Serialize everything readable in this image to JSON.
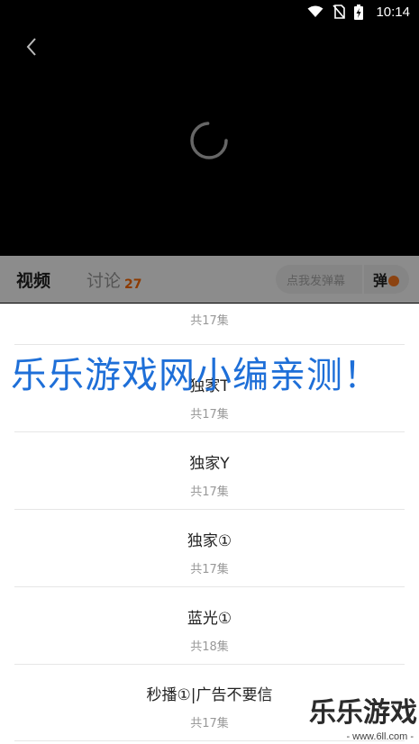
{
  "status_bar": {
    "time": "10:14"
  },
  "tabs": [
    {
      "label": "视频"
    },
    {
      "label": "讨论",
      "count": "27"
    }
  ],
  "danmu": {
    "placeholder": "点我发弹幕",
    "toggle_label": "弹"
  },
  "episodes": [
    {
      "title": "",
      "count": "共17集"
    },
    {
      "title": "独家T",
      "count": "共17集"
    },
    {
      "title": "独家Y",
      "count": "共17集"
    },
    {
      "title": "独家①",
      "count": "共17集"
    },
    {
      "title": "蓝光①",
      "count": "共18集"
    },
    {
      "title": "秒播①|广告不要信",
      "count": "共17集"
    }
  ],
  "watermark": {
    "overlay_text": "乐乐游戏网小编亲测！",
    "logo_text": "乐乐游戏",
    "logo_url": "- www.6ll.com -"
  },
  "colors": {
    "accent": "#ff6a00",
    "watermark": "#1e6fd8"
  }
}
